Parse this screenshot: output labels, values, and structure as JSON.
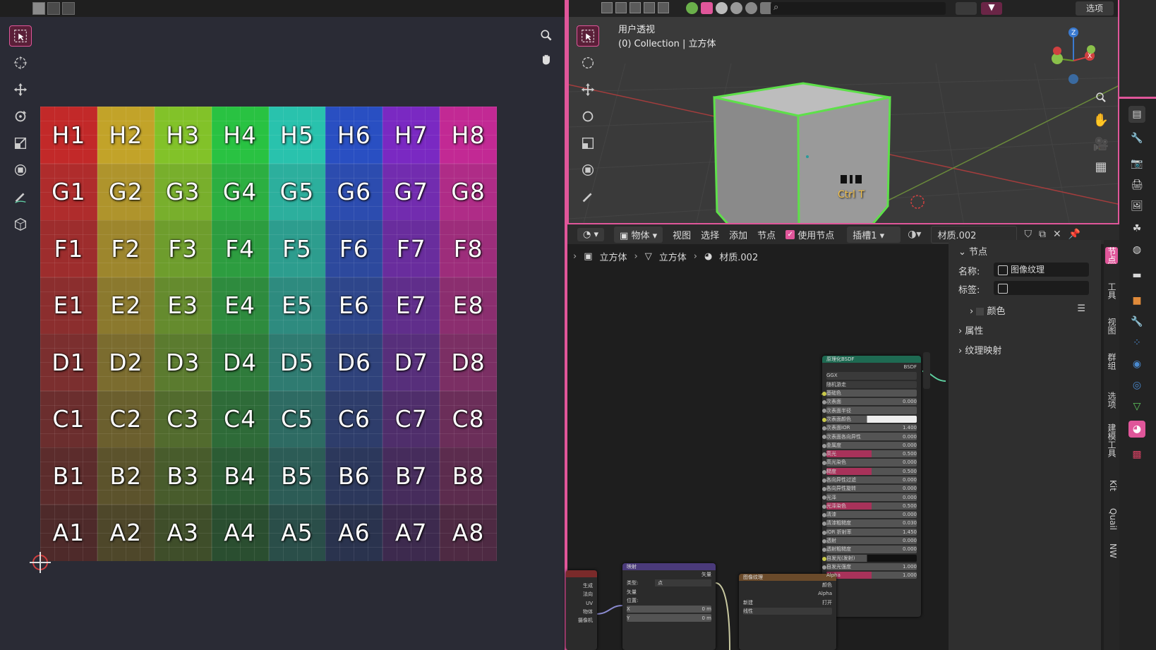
{
  "uv_editor": {
    "rows": [
      {
        "letter": "H",
        "cells": [
          "H1",
          "H2",
          "H3",
          "H4",
          "H5",
          "H6",
          "H7",
          "H8"
        ]
      },
      {
        "letter": "G",
        "cells": [
          "G1",
          "G2",
          "G3",
          "G4",
          "G5",
          "G6",
          "G7",
          "G8"
        ]
      },
      {
        "letter": "F",
        "cells": [
          "F1",
          "F2",
          "F3",
          "F4",
          "F5",
          "F6",
          "F7",
          "F8"
        ]
      },
      {
        "letter": "E",
        "cells": [
          "E1",
          "E2",
          "E3",
          "E4",
          "E5",
          "E6",
          "E7",
          "E8"
        ]
      },
      {
        "letter": "D",
        "cells": [
          "D1",
          "D2",
          "D3",
          "D4",
          "D5",
          "D6",
          "D7",
          "D8"
        ]
      },
      {
        "letter": "C",
        "cells": [
          "C1",
          "C2",
          "C3",
          "C4",
          "C5",
          "C6",
          "C7",
          "C8"
        ]
      },
      {
        "letter": "B",
        "cells": [
          "B1",
          "B2",
          "B3",
          "B4",
          "B5",
          "B6",
          "B7",
          "B8"
        ]
      },
      {
        "letter": "A",
        "cells": [
          "A1",
          "A2",
          "A3",
          "A4",
          "A5",
          "A6",
          "A7",
          "A8"
        ]
      }
    ],
    "column_hues": [
      0,
      48,
      85,
      130,
      172,
      225,
      272,
      318
    ]
  },
  "viewport": {
    "view_name": "用户透视",
    "collection": "(0) Collection | 立方体",
    "options_label": "选项",
    "shortcut_hint": "Ctrl T"
  },
  "node_editor": {
    "header": {
      "object_dd": "物体",
      "menu": [
        "视图",
        "选择",
        "添加",
        "节点"
      ],
      "use_nodes": "使用节点",
      "slot": "插槽1",
      "material": "材质.002"
    },
    "breadcrumb": [
      "立方体",
      "立方体",
      "材质.002"
    ],
    "npanel": {
      "section": "节点",
      "name_label": "名称:",
      "name_value": "图像纹理",
      "tag_label": "标签:",
      "color_label": "颜色",
      "properties_label": "属性",
      "texmap_label": "纹理映射"
    },
    "vtabs": [
      "节点",
      "工具",
      "视图",
      "群组",
      "选项",
      "建模工具",
      "Kit",
      "Quail",
      "NW"
    ],
    "bsdf": {
      "title": "原理化BSDF",
      "output": "BSDF",
      "dist": "GGX",
      "sss_method": "随机游走",
      "rows": [
        {
          "label": "基础色",
          "value": ""
        },
        {
          "label": "次表面",
          "value": "0.000"
        },
        {
          "label": "次表面半径",
          "value": ""
        },
        {
          "label": "次表面颜色",
          "value": ""
        },
        {
          "label": "次表面IOR",
          "value": "1.400"
        },
        {
          "label": "次表面各向异性",
          "value": "0.000"
        },
        {
          "label": "金属度",
          "value": "0.000"
        },
        {
          "label": "高光",
          "value": "0.500"
        },
        {
          "label": "高光染色",
          "value": "0.000"
        },
        {
          "label": "糙度",
          "value": "0.500"
        },
        {
          "label": "各向异性过滤",
          "value": "0.000"
        },
        {
          "label": "各向异性旋转",
          "value": "0.000"
        },
        {
          "label": "光泽",
          "value": "0.000"
        },
        {
          "label": "光泽染色",
          "value": "0.500"
        },
        {
          "label": "清漆",
          "value": "0.000"
        },
        {
          "label": "清漆粗糙度",
          "value": "0.030"
        },
        {
          "label": "IOR 折射率",
          "value": "1.450"
        },
        {
          "label": "透射",
          "value": "0.000"
        },
        {
          "label": "透射粗糙度",
          "value": "0.000"
        },
        {
          "label": "自发光(发射)",
          "value": ""
        },
        {
          "label": "自发光强度",
          "value": "1.000"
        },
        {
          "label": "Alpha",
          "value": "1.000"
        }
      ]
    },
    "texcoord_node": {
      "outputs": [
        "生成",
        "法向",
        "UV",
        "物体",
        "摄像机"
      ]
    },
    "mapping_node": {
      "title": "映射",
      "output": "矢量",
      "type_label": "类型:",
      "type_value": "点",
      "input": "矢量",
      "location": "位置:",
      "x_label": "X",
      "x_value": "0 m",
      "y_label": "Y",
      "y_value": "0 m"
    },
    "image_node": {
      "title": "图像纹理",
      "color": "颜色",
      "alpha": "Alpha",
      "new": "新建",
      "open": "打开",
      "interp": "线性"
    }
  },
  "colors": {
    "accent": "#e0569a",
    "selected_outline": "#5ee04a"
  }
}
